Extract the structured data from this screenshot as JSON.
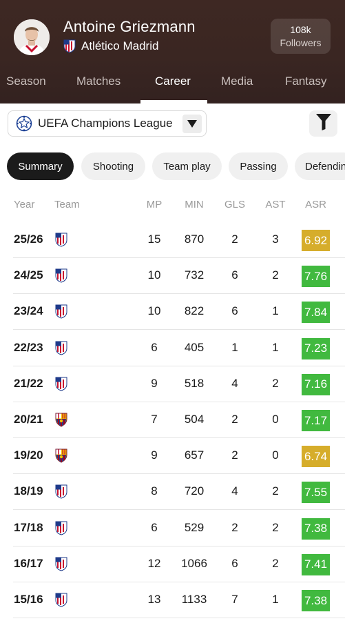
{
  "player": {
    "name": "Antoine Griezmann",
    "club": "Atlético Madrid",
    "followers_count": "108k",
    "followers_label": "Followers"
  },
  "tabs": [
    "Season",
    "Matches",
    "Career",
    "Media",
    "Fantasy"
  ],
  "active_tab": "Career",
  "competition": "UEFA Champions League",
  "stat_chips": [
    "Summary",
    "Shooting",
    "Team play",
    "Passing",
    "Defending"
  ],
  "active_chip": "Summary",
  "table": {
    "columns": [
      "Year",
      "Team",
      "MP",
      "MIN",
      "GLS",
      "AST",
      "ASR"
    ],
    "rows": [
      {
        "year": "25/26",
        "team": "Atlético Madrid",
        "mp": "15",
        "min": "870",
        "gls": "2",
        "ast": "3",
        "asr": "6.92"
      },
      {
        "year": "24/25",
        "team": "Atlético Madrid",
        "mp": "10",
        "min": "732",
        "gls": "6",
        "ast": "2",
        "asr": "7.76"
      },
      {
        "year": "23/24",
        "team": "Atlético Madrid",
        "mp": "10",
        "min": "822",
        "gls": "6",
        "ast": "1",
        "asr": "7.84"
      },
      {
        "year": "22/23",
        "team": "Atlético Madrid",
        "mp": "6",
        "min": "405",
        "gls": "1",
        "ast": "1",
        "asr": "7.23"
      },
      {
        "year": "21/22",
        "team": "Atlético Madrid",
        "mp": "9",
        "min": "518",
        "gls": "4",
        "ast": "2",
        "asr": "7.16"
      },
      {
        "year": "20/21",
        "team": "Barcelona",
        "mp": "7",
        "min": "504",
        "gls": "2",
        "ast": "0",
        "asr": "7.17"
      },
      {
        "year": "19/20",
        "team": "Barcelona",
        "mp": "9",
        "min": "657",
        "gls": "2",
        "ast": "0",
        "asr": "6.74"
      },
      {
        "year": "18/19",
        "team": "Atlético Madrid",
        "mp": "8",
        "min": "720",
        "gls": "4",
        "ast": "2",
        "asr": "7.55"
      },
      {
        "year": "17/18",
        "team": "Atlético Madrid",
        "mp": "6",
        "min": "529",
        "gls": "2",
        "ast": "2",
        "asr": "7.38"
      },
      {
        "year": "16/17",
        "team": "Atlético Madrid",
        "mp": "12",
        "min": "1066",
        "gls": "6",
        "ast": "2",
        "asr": "7.41"
      },
      {
        "year": "15/16",
        "team": "Atlético Madrid",
        "mp": "13",
        "min": "1133",
        "gls": "7",
        "ast": "1",
        "asr": "7.38"
      }
    ]
  },
  "colors": {
    "rating_green": "#41b93f",
    "rating_amber": "#d6ad2b",
    "header_bg": "#3c2722"
  },
  "icons": {
    "competition": "champions-league-ball-icon",
    "dropdown": "caret-down-icon",
    "filter": "filter-funnel-icon",
    "atletico": "atletico-madrid-crest-icon",
    "barcelona": "fc-barcelona-crest-icon"
  }
}
